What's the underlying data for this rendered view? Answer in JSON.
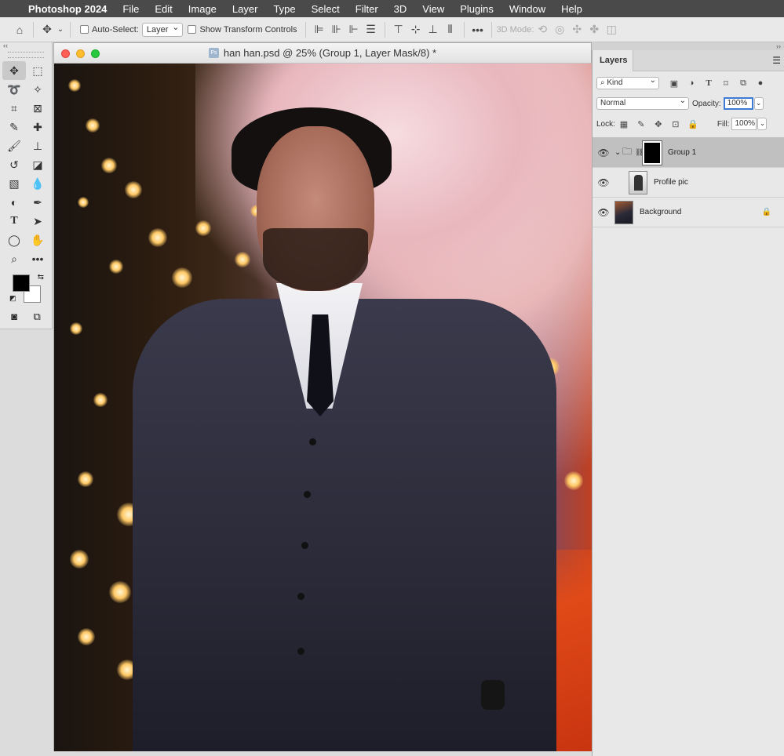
{
  "menubar": {
    "apple_icon": "apple-icon",
    "app_name": "Photoshop 2024",
    "items": [
      "File",
      "Edit",
      "Image",
      "Layer",
      "Type",
      "Select",
      "Filter",
      "3D",
      "View",
      "Plugins",
      "Window",
      "Help"
    ]
  },
  "options_bar": {
    "auto_select_label": "Auto-Select:",
    "auto_select_value": "Layer",
    "show_transform_label": "Show Transform Controls",
    "three_d_mode_label": "3D Mode:"
  },
  "tools_panel": {
    "collapse_label": "‹‹",
    "foreground_color": "#000000",
    "background_color": "#ffffff"
  },
  "document": {
    "title": "han han.psd @ 25% (Group 1, Layer Mask/8) *",
    "badge": "Ps"
  },
  "layers_panel": {
    "collapse_label": "››",
    "tab_label": "Layers",
    "filter_kind": "Kind",
    "blend_mode": "Normal",
    "opacity_label": "Opacity:",
    "opacity_value": "100%",
    "lock_label": "Lock:",
    "fill_label": "Fill:",
    "fill_value": "100%",
    "layers": [
      {
        "name": "Group 1",
        "type": "group",
        "selected": true
      },
      {
        "name": "Profile pic",
        "type": "smart-object",
        "selected": false
      },
      {
        "name": "Background",
        "type": "background",
        "selected": false,
        "locked": true
      }
    ]
  }
}
